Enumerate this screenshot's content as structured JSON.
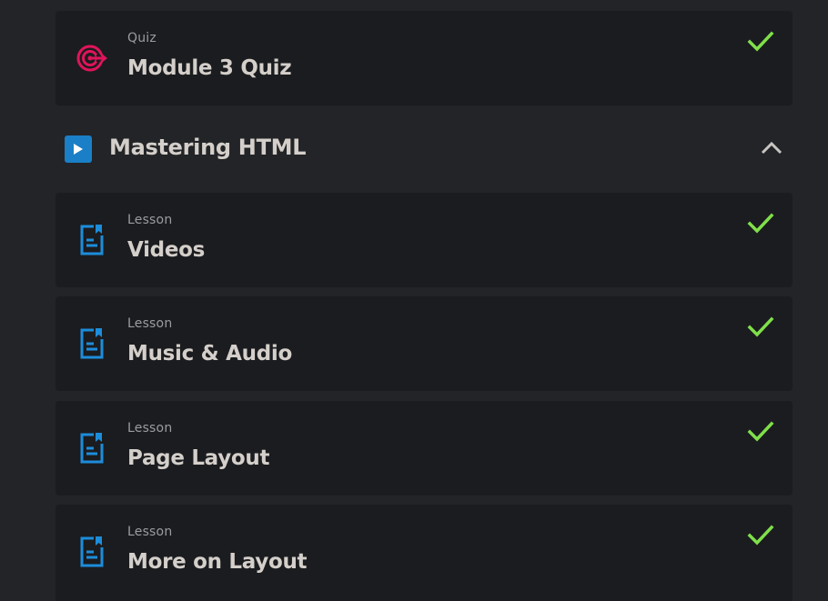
{
  "colors": {
    "background": "#232427",
    "card": "#1b1c1f",
    "check": "#7fe04a",
    "quiz_icon": "#e0145a",
    "lesson_icon": "#1c8ddb",
    "play_bg": "#1a7fc6"
  },
  "quiz_item": {
    "type": "Quiz",
    "title": "Module 3 Quiz",
    "icon": "target-icon",
    "completed": true
  },
  "section": {
    "title": "Mastering HTML",
    "icon": "play-icon",
    "expanded": true
  },
  "lessons": [
    {
      "type": "Lesson",
      "title": "Videos",
      "icon": "document-icon",
      "completed": true
    },
    {
      "type": "Lesson",
      "title": "Music & Audio",
      "icon": "document-icon",
      "completed": true
    },
    {
      "type": "Lesson",
      "title": "Page Layout",
      "icon": "document-icon",
      "completed": true
    },
    {
      "type": "Lesson",
      "title": "More on Layout",
      "icon": "document-icon",
      "completed": true
    }
  ]
}
